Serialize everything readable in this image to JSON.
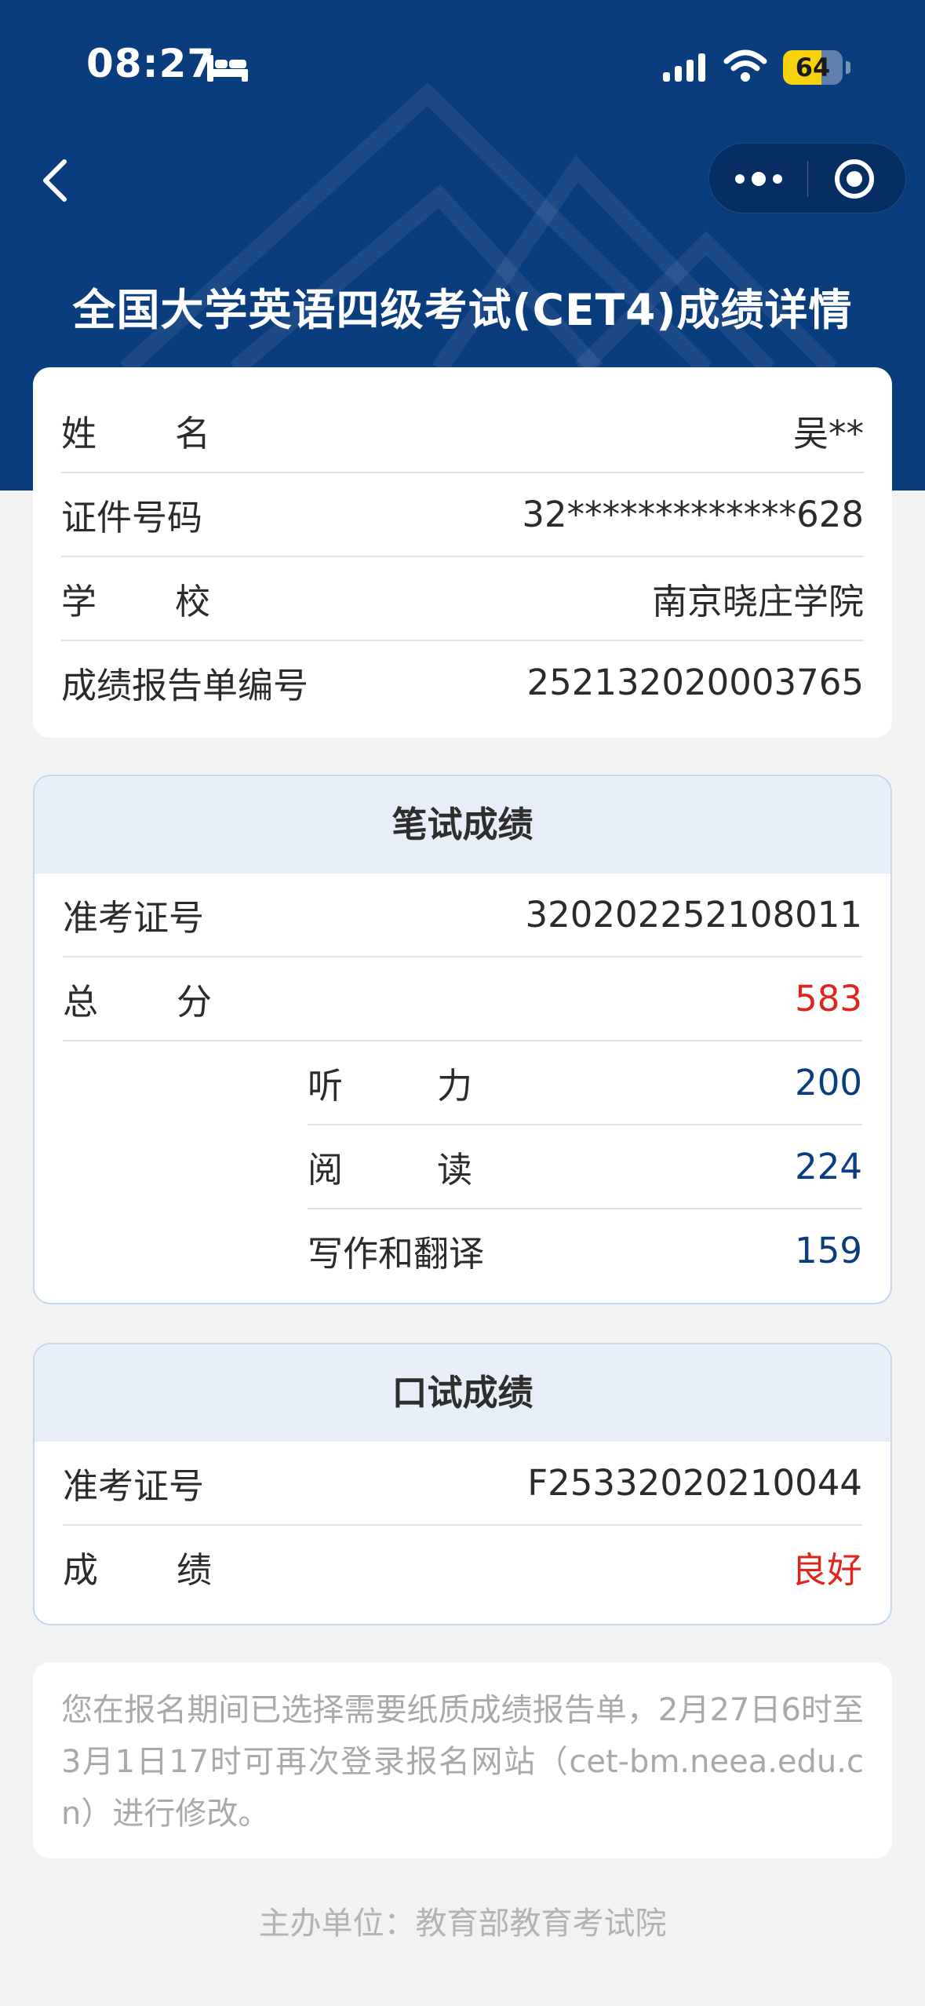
{
  "status_bar": {
    "time": "08:27",
    "battery_level": 64,
    "battery_text": "64",
    "icons": [
      "bed-icon",
      "signal-icon",
      "wifi-icon",
      "battery-icon"
    ]
  },
  "nav": {
    "back_icon": "chevron-left-icon",
    "more_icon": "more-dots-icon",
    "close_icon": "target-icon"
  },
  "page_title": "全国大学英语四级考试(CET4)成绩详情",
  "info": {
    "name_label": "姓名",
    "name_value": "吴**",
    "id_label": "证件号码",
    "id_value": "32*************628",
    "school_label": "学校",
    "school_value": "南京晓庄学院",
    "report_label": "成绩报告单编号",
    "report_value": "252132020003765"
  },
  "written": {
    "title": "笔试成绩",
    "ticket_label": "准考证号",
    "ticket_value": "320202252108011",
    "total_label": "总分",
    "total_value": "583",
    "listening_label": "听力",
    "listening_value": "200",
    "reading_label": "阅读",
    "reading_value": "224",
    "writing_label": "写作和翻译",
    "writing_value": "159"
  },
  "oral": {
    "title": "口试成绩",
    "ticket_label": "准考证号",
    "ticket_value": "F25332020210044",
    "grade_label": "成绩",
    "grade_value": "良好"
  },
  "notice": "您在报名期间已选择需要纸质成绩报告单，2月27日6时至3月1日17时可再次登录报名网站（cet-bm.neea.edu.cn）进行修改。",
  "footer": "主办单位：教育部教育考试院",
  "colors": {
    "header_blue": "#0a3d7e",
    "score_red": "#e0261c",
    "score_blue": "#0a3d7e"
  }
}
